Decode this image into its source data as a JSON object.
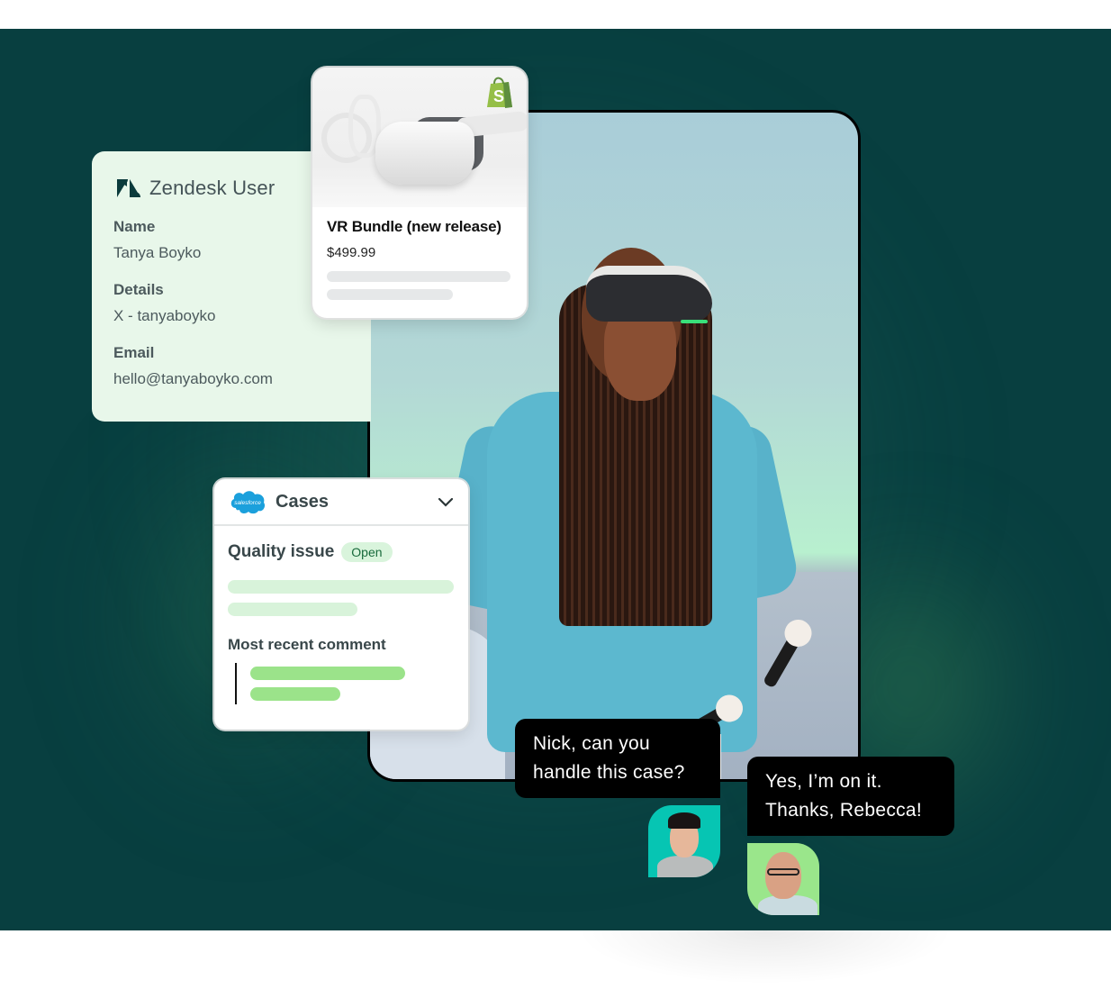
{
  "zendesk": {
    "title": "Zendesk User",
    "logo_icon": "zendesk-logo-icon",
    "fields": [
      {
        "label": "Name",
        "value": "Tanya Boyko"
      },
      {
        "label": "Details",
        "value": "X - tanyaboyko"
      },
      {
        "label": "Email",
        "value": "hello@tanyaboyko.com"
      }
    ],
    "bg_color": "#e8f7ea"
  },
  "product": {
    "name": "VR Bundle (new release)",
    "price": "$499.99",
    "store_icon": "shopify-bag-icon",
    "image_alt": "VR headset with controllers"
  },
  "salesforce": {
    "logo_text": "salesforce",
    "title": "Cases",
    "case_title": "Quality issue",
    "status": "Open",
    "section_label": "Most recent comment",
    "accent_color": "#9be38a",
    "badge_bg": "#d9f4dc"
  },
  "chat": {
    "messages": [
      {
        "text_line1": "Nick, can you",
        "text_line2": "handle this case?",
        "avatar_bg": "#06c5b3"
      },
      {
        "text_line1": "Yes, I’m on it.",
        "text_line2": "Thanks, Rebecca!",
        "avatar_bg": "#9ae68b"
      }
    ]
  },
  "photo": {
    "alt": "Woman wearing VR headset holding motion controllers"
  },
  "theme": {
    "background": "#083f40"
  }
}
